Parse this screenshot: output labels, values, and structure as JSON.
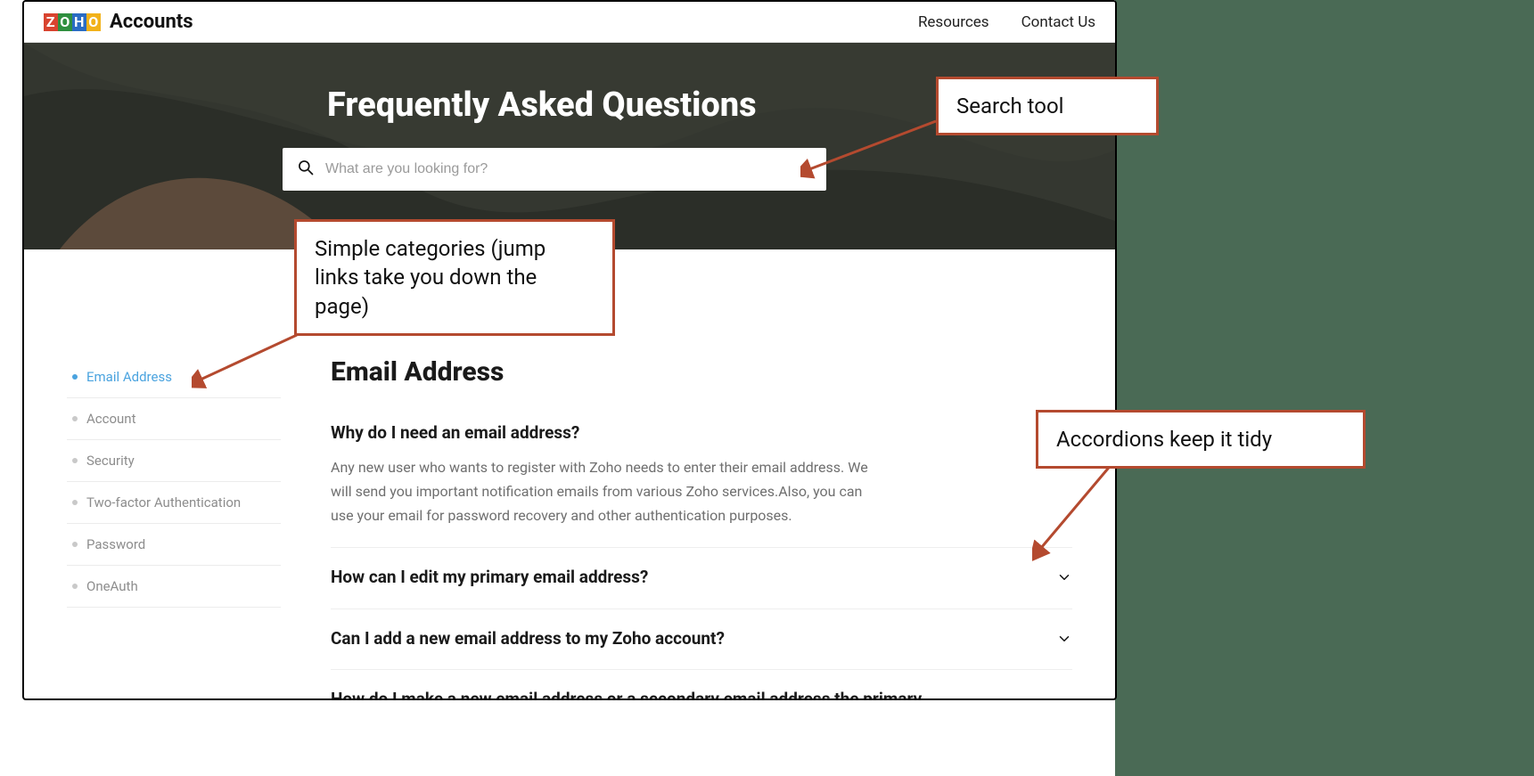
{
  "brand": {
    "name": "Accounts",
    "logo_letters": [
      "Z",
      "O",
      "H",
      "O"
    ]
  },
  "nav": {
    "resources": "Resources",
    "contact": "Contact Us"
  },
  "hero": {
    "title": "Frequently Asked Questions",
    "search_placeholder": "What are you looking for?"
  },
  "sidebar": {
    "items": [
      {
        "label": "Email Address",
        "active": true
      },
      {
        "label": "Account"
      },
      {
        "label": "Security"
      },
      {
        "label": "Two-factor Authentication"
      },
      {
        "label": "Password"
      },
      {
        "label": "OneAuth"
      }
    ]
  },
  "section": {
    "title": "Email Address"
  },
  "faqs": [
    {
      "q": "Why do I need an email address?",
      "a": "Any new user who wants to register with Zoho needs to enter their email address. We will send you important notification emails from various Zoho services.Also, you can use your email for password recovery and other authentication purposes.",
      "open": true
    },
    {
      "q": "How can I edit my primary email address?",
      "open": false
    },
    {
      "q": "Can I add a new email address to my Zoho account?",
      "open": false
    },
    {
      "q": "How do I make a new email address or a secondary email address the primary",
      "open": false
    }
  ],
  "annotations": {
    "search_tool": "Search tool",
    "categories": "Simple categories (jump links take you down the page)",
    "accordions": "Accordions keep it tidy"
  }
}
